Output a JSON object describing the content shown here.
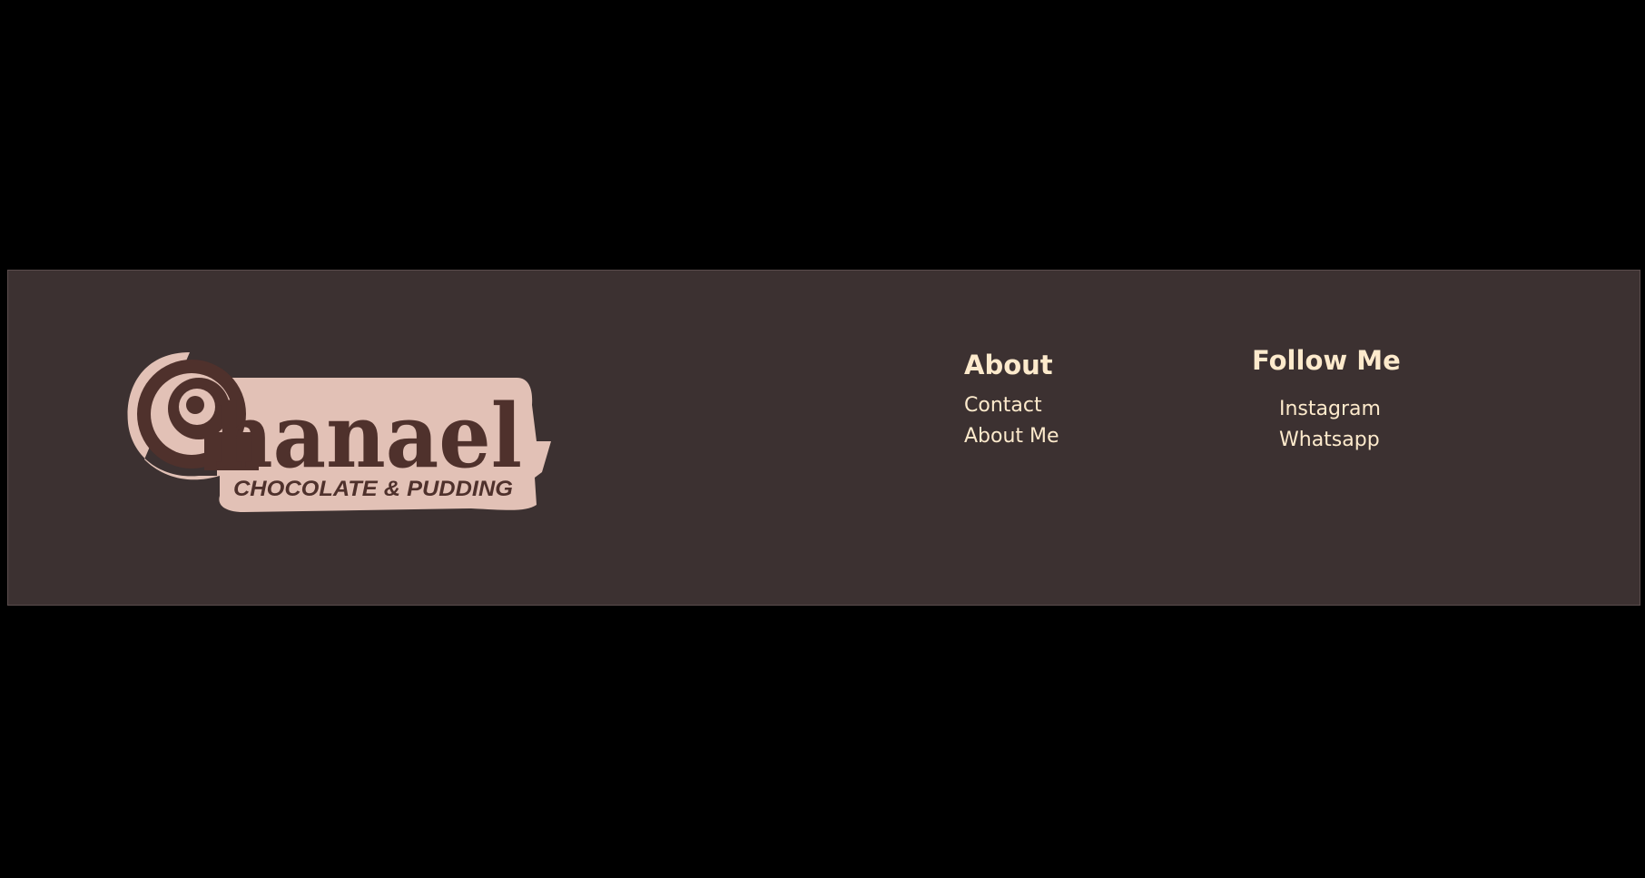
{
  "logo": {
    "wordmark": "hanael",
    "tagline": "CHOCOLATE & PUDDING",
    "colors": {
      "badge": "#e2c1b6",
      "ink": "#4f312c"
    }
  },
  "footer": {
    "background": "#3c3131",
    "text_color": "#fdeacc",
    "about": {
      "title": "About",
      "links": [
        {
          "label": "Contact"
        },
        {
          "label": "About Me"
        }
      ]
    },
    "follow": {
      "title": "Follow Me",
      "links": [
        {
          "label": "Instagram"
        },
        {
          "label": "Whatsapp"
        }
      ]
    }
  }
}
